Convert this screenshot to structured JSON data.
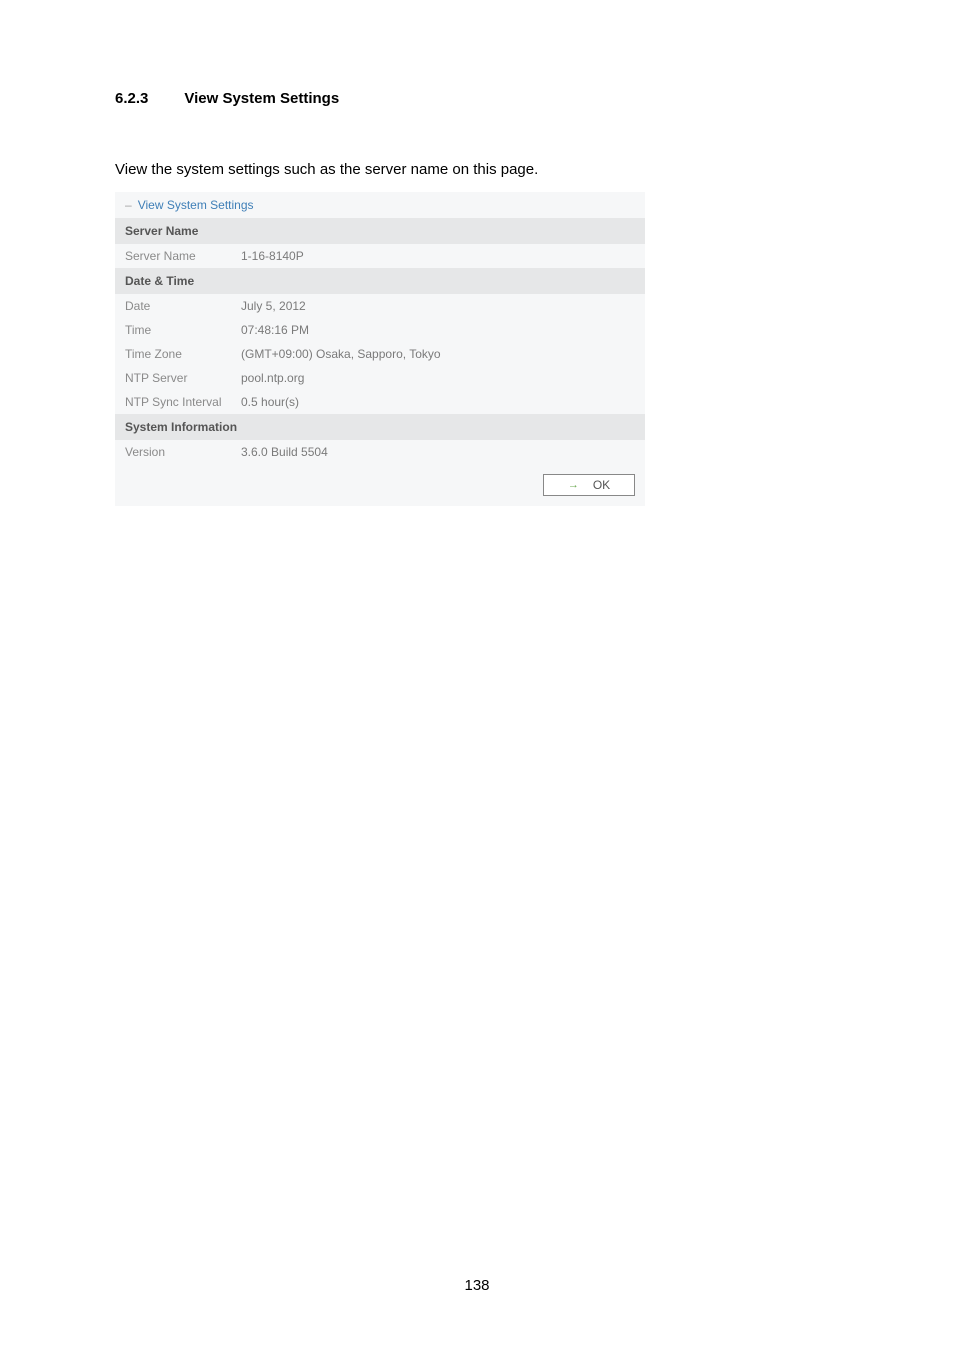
{
  "heading": {
    "number": "6.2.3",
    "title": "View System Settings"
  },
  "intro": "View the system settings such as the server name on this page.",
  "panel_title": "View System Settings",
  "sections": {
    "server_name": {
      "header": "Server Name",
      "rows": {
        "server_name": {
          "label": "Server Name",
          "value": "1-16-8140P"
        }
      }
    },
    "date_time": {
      "header": "Date & Time",
      "rows": {
        "date": {
          "label": "Date",
          "value": "July 5, 2012"
        },
        "time": {
          "label": "Time",
          "value": "07:48:16 PM"
        },
        "time_zone": {
          "label": "Time Zone",
          "value": "(GMT+09:00) Osaka, Sapporo, Tokyo"
        },
        "ntp_server": {
          "label": "NTP Server",
          "value": "pool.ntp.org"
        },
        "ntp_sync": {
          "label": "NTP Sync Interval",
          "value": "0.5 hour(s)"
        }
      }
    },
    "system_info": {
      "header": "System Information",
      "rows": {
        "version": {
          "label": "Version",
          "value": "3.6.0 Build 5504"
        }
      }
    }
  },
  "ok_label": "OK",
  "page_number": "138"
}
